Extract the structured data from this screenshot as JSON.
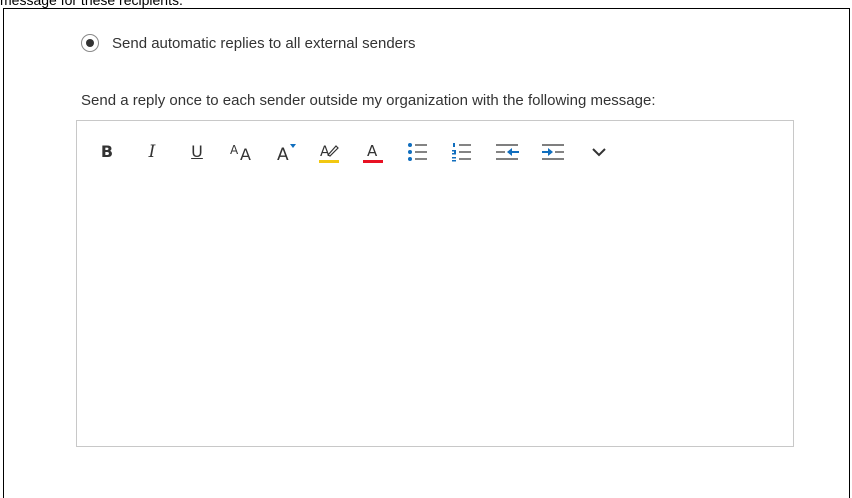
{
  "top_cut_text": "message for these recipients.",
  "external_replies": {
    "radio_label": "Send automatic replies to all external senders",
    "selected": true
  },
  "instruction": "Send a reply once to each sender outside my organization with the following message:",
  "editor": {
    "content": "",
    "toolbar": [
      {
        "name": "bold-icon",
        "glyph": "B"
      },
      {
        "name": "italic-icon",
        "glyph": "I"
      },
      {
        "name": "underline-icon",
        "glyph": "U"
      },
      {
        "name": "font-size-icon",
        "glyph": "AA"
      },
      {
        "name": "increase-font-size-icon",
        "glyph": "A"
      },
      {
        "name": "highlight-icon",
        "glyph": "A"
      },
      {
        "name": "font-color-icon",
        "glyph": "A"
      },
      {
        "name": "bullets-icon"
      },
      {
        "name": "numbering-icon"
      },
      {
        "name": "decrease-indent-icon"
      },
      {
        "name": "increase-indent-icon"
      },
      {
        "name": "chevron-down-icon"
      }
    ]
  },
  "colors": {
    "highlight_underline": "#f2c811",
    "font_color_underline": "#e81123",
    "accent_blue": "#106ebe",
    "text": "#333333",
    "border": "#c8c8c8"
  }
}
